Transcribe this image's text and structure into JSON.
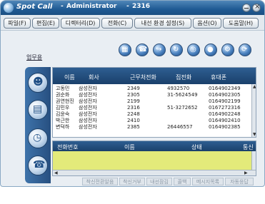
{
  "window": {
    "app_name": "Spot Call",
    "separator": "-",
    "user": "Administrator",
    "extension": "2316"
  },
  "menu": [
    "파일(F)",
    "편집(E)",
    "디렉터리(D)",
    "전화(C)",
    "내선 환경 설정(S)",
    "옵션(O)",
    "도움말(H)"
  ],
  "left_link": "업무용",
  "toolbar_icons": [
    "directory-icon",
    "call-icon",
    "transfer-icon",
    "redial-icon",
    "conference-icon",
    "record-icon",
    "settings-icon",
    "refresh-icon"
  ],
  "directory_table": {
    "columns": [
      "이름",
      "회사",
      "근무처전화",
      "집전화",
      "휴대폰"
    ],
    "rows": [
      [
        "고동민",
        "삼성전자",
        "2349",
        "4932570",
        "0164902349"
      ],
      [
        "권순화",
        "삼성전자",
        "2305",
        "31-5624549",
        "0164902305"
      ],
      [
        "권연현진",
        "삼성전자",
        "2199",
        "",
        "0164902199"
      ],
      [
        "김민우",
        "삼성전자",
        "2316",
        "51-3272652",
        "0167272316"
      ],
      [
        "김윤숙",
        "삼성전자",
        "2248",
        "",
        "0164902248"
      ],
      [
        "박근한",
        "삼성전자",
        "2410",
        "",
        "0164902410"
      ],
      [
        "변덕하",
        "삼성전자",
        "2385",
        "26446557",
        "0164902385"
      ]
    ]
  },
  "call_log_table": {
    "columns": [
      "전화번호",
      "이름",
      "상태",
      "통신"
    ]
  },
  "sidebar_icons": [
    "my-contacts-icon",
    "phone-book-icon",
    "clock-icon",
    "call-icon"
  ],
  "bottom_buttons": [
    "착신전환알음",
    "착신거부",
    "내선잠김",
    "콜백",
    "메시지목록",
    "자동응답"
  ]
}
